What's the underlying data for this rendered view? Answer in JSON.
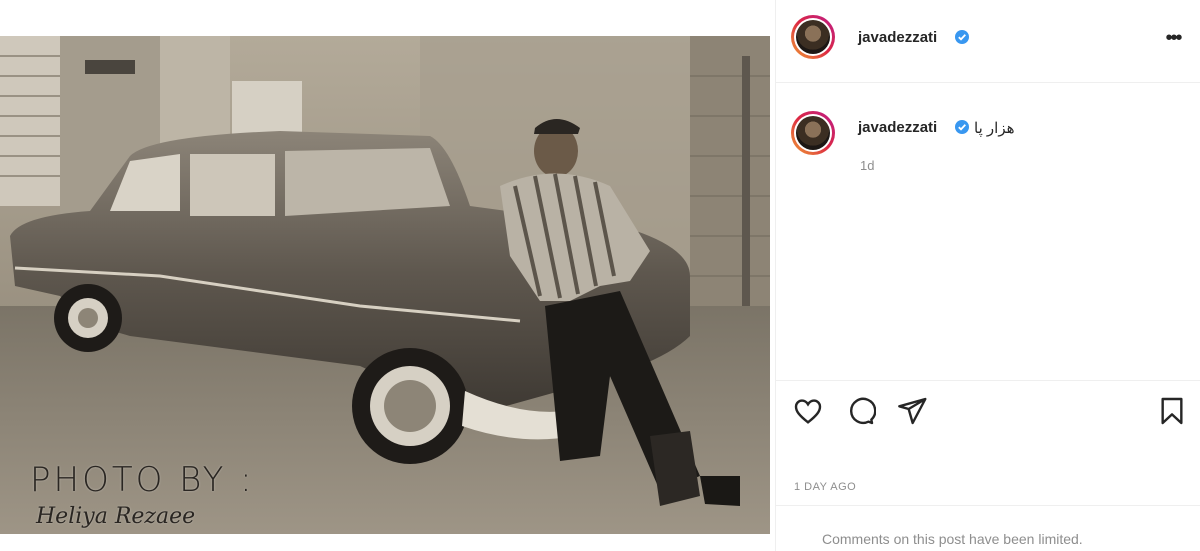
{
  "post": {
    "username": "javadezzati",
    "verified": true,
    "more_icon": "more-horizontal-icon",
    "caption": {
      "username": "javadezzati",
      "text": "هزار پا",
      "age": "1d"
    },
    "photo": {
      "credit_line1": "PHOTO BY :",
      "credit_line2": "Heliya Rezaee"
    },
    "actions": {
      "like_icon": "heart-icon",
      "comment_icon": "comment-icon",
      "share_icon": "paper-plane-icon",
      "save_icon": "bookmark-icon"
    },
    "date": "1 DAY AGO",
    "comments_notice": "Comments on this post have been limited."
  },
  "colors": {
    "verified_badge": "#3897f0",
    "secondary_text": "#8e8e8e",
    "primary_text": "#262626",
    "divider": "#efefef"
  }
}
